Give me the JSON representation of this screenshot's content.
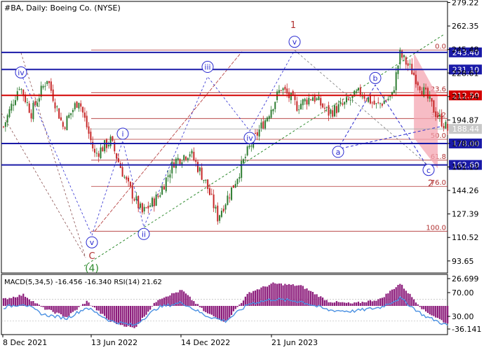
{
  "header": {
    "title": "#BA, Daily:  Boeing Co. (NYSE)",
    "macd_label": "MACD(5,34,5) -16.456 -16.340 RSI(14) 21.62"
  },
  "colors": {
    "up": "#2e7d32",
    "down": "#c62828",
    "blue_level": "#1a1aa8",
    "red_level": "#d40000",
    "thin_red": "#b03030",
    "green_dash": "#2e8b2e",
    "forecast_fill": "#f4a6b2",
    "macd_hist": "#8b1a7a",
    "macd_line": "#4a90e2",
    "current_price_bg": "#c8c8c8"
  },
  "chart_data": [
    {
      "type": "candlestick",
      "title": "#BA, Daily:  Boeing Co. (NYSE)",
      "ylim": [
        85,
        280
      ],
      "y_ticks": [
        93.65,
        110.52,
        127.39,
        144.26,
        161.13,
        178.0,
        194.87,
        211.74,
        228.61,
        245.48,
        262.35,
        279.22
      ],
      "x_ticks": [
        "8 Dec 2021",
        "13 Jun 2022",
        "14 Dec 2022",
        "21 Jun 2023"
      ],
      "horizontal_levels": [
        {
          "value": 243.4,
          "label": "243.40",
          "kind": "blue"
        },
        {
          "value": 231.1,
          "label": "231.10",
          "kind": "blue"
        },
        {
          "value": 212.5,
          "label": "212.50",
          "kind": "red"
        },
        {
          "value": 178.0,
          "label": "178.00",
          "kind": "blue"
        },
        {
          "value": 162.6,
          "label": "162.60",
          "kind": "blue"
        }
      ],
      "current_price": {
        "value": 188.44,
        "label": "188.44"
      },
      "fibonacci": [
        {
          "label": "0.0",
          "value": 245
        },
        {
          "label": "23.6",
          "value": 214.5
        },
        {
          "label": "38.2",
          "value": 195.9
        },
        {
          "label": "50.0",
          "value": 181
        },
        {
          "label": "61.8",
          "value": 166
        },
        {
          "label": "76.0",
          "value": 147.2
        },
        {
          "label": "100.0",
          "value": 115
        }
      ],
      "wave_labels": [
        {
          "text": "iv",
          "style": "circle"
        },
        {
          "text": "v",
          "style": "circle"
        },
        {
          "text": "C",
          "style": "plain-red"
        },
        {
          "text": "(4)",
          "style": "plain-green"
        },
        {
          "text": "i",
          "style": "circle"
        },
        {
          "text": "ii",
          "style": "circle"
        },
        {
          "text": "iii",
          "style": "circle"
        },
        {
          "text": "iv",
          "style": "circle"
        },
        {
          "text": "v",
          "style": "circle"
        },
        {
          "text": "1",
          "style": "plain-red"
        },
        {
          "text": "2",
          "style": "plain-red"
        },
        {
          "text": "a",
          "style": "circle"
        },
        {
          "text": "b",
          "style": "circle"
        },
        {
          "text": "c",
          "style": "circle"
        }
      ],
      "price_path": [
        {
          "i": 0,
          "v": 190
        },
        {
          "i": 8,
          "v": 220
        },
        {
          "i": 14,
          "v": 200
        },
        {
          "i": 22,
          "v": 225
        },
        {
          "i": 30,
          "v": 190
        },
        {
          "i": 38,
          "v": 210
        },
        {
          "i": 46,
          "v": 170
        },
        {
          "i": 54,
          "v": 180
        },
        {
          "i": 62,
          "v": 150
        },
        {
          "i": 70,
          "v": 128
        },
        {
          "i": 78,
          "v": 140
        },
        {
          "i": 86,
          "v": 165
        },
        {
          "i": 94,
          "v": 172
        },
        {
          "i": 102,
          "v": 150
        },
        {
          "i": 108,
          "v": 125
        },
        {
          "i": 116,
          "v": 148
        },
        {
          "i": 124,
          "v": 175
        },
        {
          "i": 132,
          "v": 195
        },
        {
          "i": 140,
          "v": 218
        },
        {
          "i": 148,
          "v": 205
        },
        {
          "i": 156,
          "v": 212
        },
        {
          "i": 164,
          "v": 200
        },
        {
          "i": 172,
          "v": 206
        },
        {
          "i": 180,
          "v": 215
        },
        {
          "i": 188,
          "v": 205
        },
        {
          "i": 196,
          "v": 212
        },
        {
          "i": 200,
          "v": 242
        },
        {
          "i": 206,
          "v": 230
        },
        {
          "i": 212,
          "v": 215
        },
        {
          "i": 218,
          "v": 200
        },
        {
          "i": 224,
          "v": 188
        }
      ]
    },
    {
      "type": "macd",
      "title": "MACD(5,34,5) -16.456 -16.340 RSI(14) 21.62",
      "y_ticks": [
        "26.699",
        "70.00",
        "30.00",
        "-36.141"
      ],
      "histogram_path": [
        {
          "i": 0,
          "v": 6
        },
        {
          "i": 10,
          "v": 10
        },
        {
          "i": 20,
          "v": -2
        },
        {
          "i": 32,
          "v": -10
        },
        {
          "i": 42,
          "v": 4
        },
        {
          "i": 54,
          "v": -14
        },
        {
          "i": 66,
          "v": -20
        },
        {
          "i": 78,
          "v": 6
        },
        {
          "i": 90,
          "v": 14
        },
        {
          "i": 102,
          "v": -6
        },
        {
          "i": 112,
          "v": -14
        },
        {
          "i": 124,
          "v": 12
        },
        {
          "i": 136,
          "v": 20
        },
        {
          "i": 150,
          "v": 18
        },
        {
          "i": 164,
          "v": 4
        },
        {
          "i": 176,
          "v": 2
        },
        {
          "i": 190,
          "v": 6
        },
        {
          "i": 200,
          "v": 20
        },
        {
          "i": 212,
          "v": -4
        },
        {
          "i": 224,
          "v": -16
        }
      ],
      "rsi_path": [
        {
          "i": 0,
          "v": 55
        },
        {
          "i": 10,
          "v": 62
        },
        {
          "i": 20,
          "v": 42
        },
        {
          "i": 32,
          "v": 35
        },
        {
          "i": 42,
          "v": 55
        },
        {
          "i": 54,
          "v": 30
        },
        {
          "i": 66,
          "v": 22
        },
        {
          "i": 78,
          "v": 55
        },
        {
          "i": 90,
          "v": 64
        },
        {
          "i": 102,
          "v": 40
        },
        {
          "i": 112,
          "v": 30
        },
        {
          "i": 124,
          "v": 62
        },
        {
          "i": 136,
          "v": 70
        },
        {
          "i": 150,
          "v": 66
        },
        {
          "i": 164,
          "v": 50
        },
        {
          "i": 176,
          "v": 48
        },
        {
          "i": 190,
          "v": 55
        },
        {
          "i": 200,
          "v": 72
        },
        {
          "i": 212,
          "v": 40
        },
        {
          "i": 224,
          "v": 21.62
        }
      ]
    }
  ]
}
